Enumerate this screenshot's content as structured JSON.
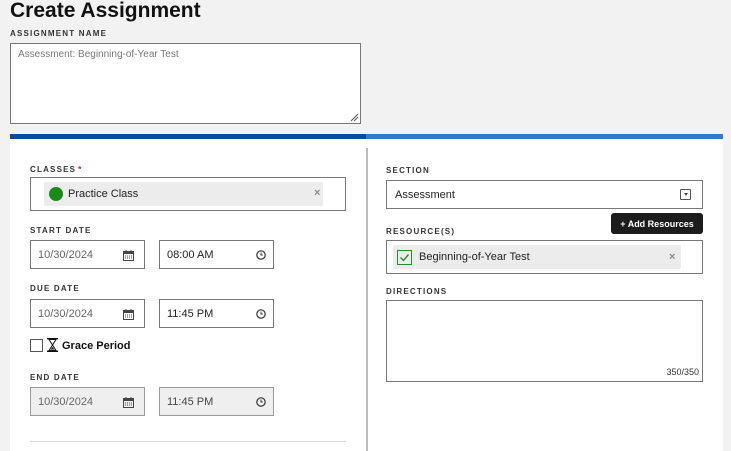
{
  "page": {
    "title": "Create Assignment"
  },
  "assignment_name": {
    "label": "ASSIGNMENT NAME",
    "placeholder": "Assessment: Beginning-of-Year Test"
  },
  "classes": {
    "label": "CLASSES",
    "required_mark": "*",
    "selected": "Practice Class",
    "selected_color": "#1a8a1a",
    "remove_label": "×"
  },
  "start": {
    "label": "START DATE",
    "date": "10/30/2024",
    "time": "08:00 AM"
  },
  "due": {
    "label": "DUE DATE",
    "date": "10/30/2024",
    "time": "11:45 PM"
  },
  "grace": {
    "label": "Grace Period",
    "checked": false
  },
  "end": {
    "label": "END DATE",
    "date": "10/30/2024",
    "time": "11:45 PM"
  },
  "section": {
    "label": "SECTION",
    "value": "Assessment"
  },
  "resources": {
    "label": "RESOURCE(S)",
    "add_button": "+ Add Resources",
    "items": [
      {
        "label": "Beginning-of-Year Test",
        "remove_label": "×"
      }
    ]
  },
  "directions": {
    "label": "DIRECTIONS",
    "counter": "350/350"
  },
  "colors": {
    "accent_dark": "#0d4a9e",
    "accent_light": "#3a78c3",
    "button_bg": "#1c1c1c"
  },
  "icons": {
    "calendar": "calendar-icon",
    "clock": "clock-icon",
    "hourglass": "hourglass-icon",
    "check": "check-icon",
    "dropdown": "dropdown-arrow-icon"
  }
}
